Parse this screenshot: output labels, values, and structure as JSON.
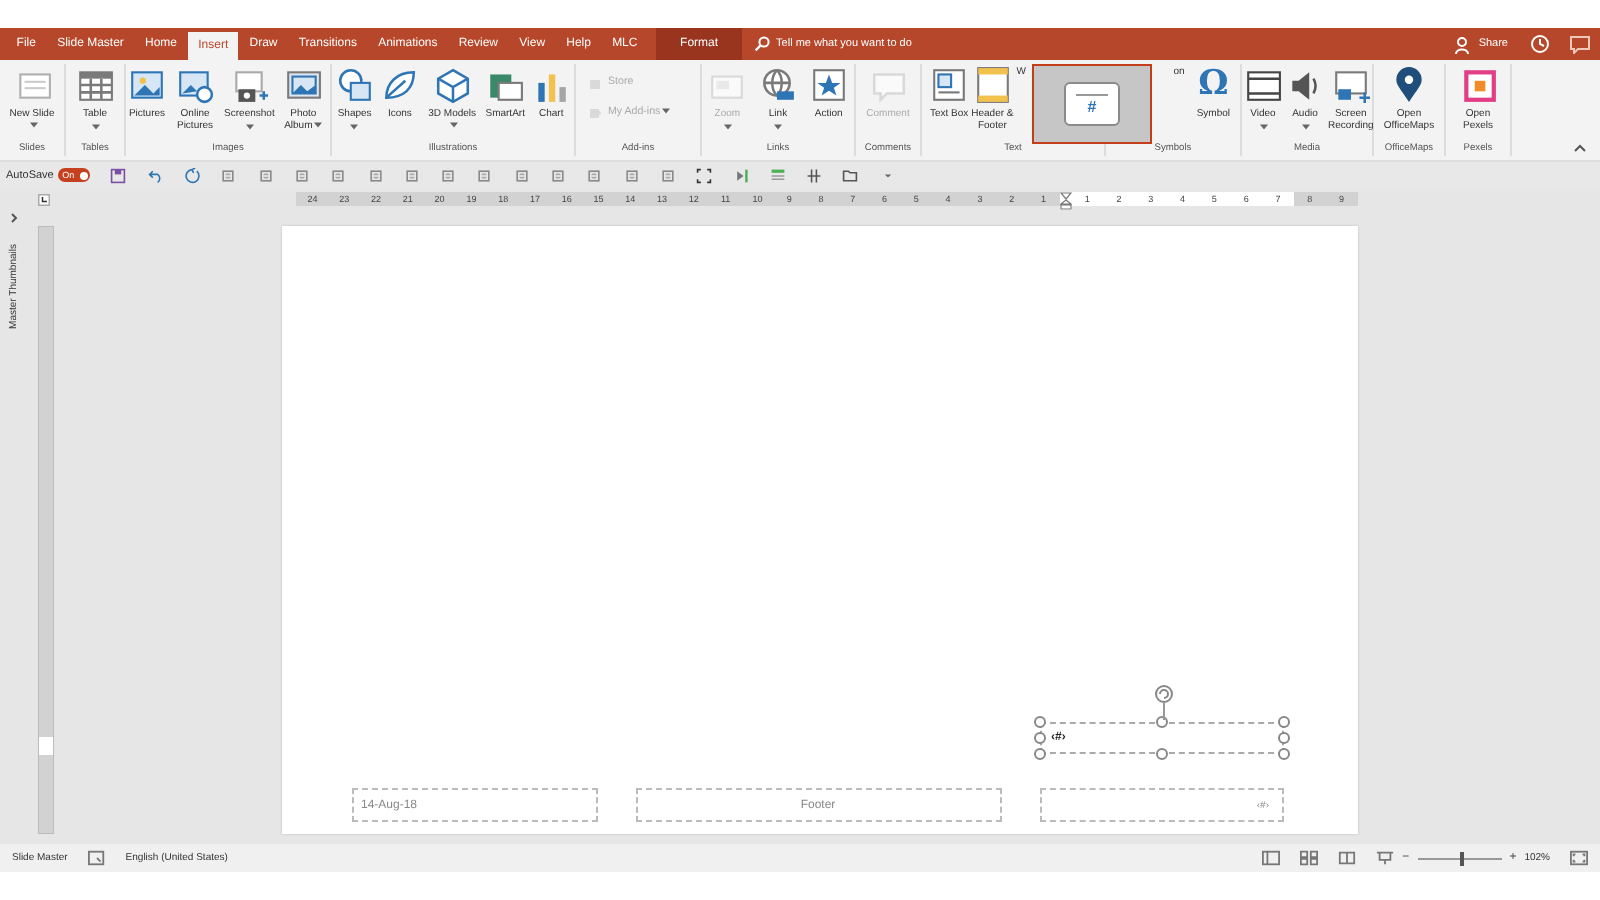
{
  "tabs": [
    {
      "label": "File",
      "selected": false,
      "contextual": false
    },
    {
      "label": "Slide Master",
      "selected": false,
      "contextual": false
    },
    {
      "label": "Home",
      "selected": false,
      "contextual": false
    },
    {
      "label": "Insert",
      "selected": true,
      "contextual": false
    },
    {
      "label": "Draw",
      "selected": false,
      "contextual": false
    },
    {
      "label": "Transitions",
      "selected": false,
      "contextual": false
    },
    {
      "label": "Animations",
      "selected": false,
      "contextual": false
    },
    {
      "label": "Review",
      "selected": false,
      "contextual": false
    },
    {
      "label": "View",
      "selected": false,
      "contextual": false
    },
    {
      "label": "Help",
      "selected": false,
      "contextual": false
    },
    {
      "label": "MLC",
      "selected": false,
      "contextual": false
    },
    {
      "label": "Format",
      "selected": false,
      "contextual": true
    }
  ],
  "tell_me": {
    "placeholder": "Tell me what you want to do"
  },
  "share": "Share",
  "ribbon": {
    "groups": [
      {
        "label": "Slides",
        "kind": "large",
        "buttons": [
          {
            "label": "New Slide",
            "kind": "caret-inline",
            "disabled": false
          }
        ]
      },
      {
        "label": "Tables",
        "kind": "large",
        "buttons": [
          {
            "label": "Table",
            "kind": "caret-below",
            "disabled": false
          }
        ]
      },
      {
        "label": "Images",
        "kind": "large",
        "buttons": [
          {
            "label": "Pictures",
            "kind": "plain",
            "disabled": false
          },
          {
            "label": "Online Pictures",
            "kind": "plain",
            "disabled": false
          },
          {
            "label": "Screenshot",
            "kind": "caret-below",
            "disabled": false
          },
          {
            "label": "Photo Album",
            "kind": "caret-inline",
            "disabled": false
          }
        ]
      },
      {
        "label": "Illustrations",
        "kind": "large",
        "buttons": [
          {
            "label": "Shapes",
            "kind": "caret-below",
            "disabled": false
          },
          {
            "label": "Icons",
            "kind": "plain",
            "disabled": false
          },
          {
            "label": "3D Models",
            "kind": "caret-inline",
            "disabled": false
          },
          {
            "label": "SmartArt",
            "kind": "plain",
            "disabled": false
          },
          {
            "label": "Chart",
            "kind": "plain",
            "disabled": false
          }
        ]
      },
      {
        "label": "Add-ins",
        "kind": "compact",
        "buttons": [
          {
            "label": "Store",
            "kind": "plain",
            "disabled": true
          },
          {
            "label": "My Add-ins",
            "kind": "caret-inline",
            "disabled": true
          }
        ]
      },
      {
        "label": "Links",
        "kind": "large",
        "buttons": [
          {
            "label": "Zoom",
            "kind": "caret-below",
            "disabled": true
          },
          {
            "label": "Link",
            "kind": "caret-below",
            "disabled": false
          },
          {
            "label": "Action",
            "kind": "plain",
            "disabled": false
          }
        ]
      },
      {
        "label": "Comments",
        "kind": "large",
        "buttons": [
          {
            "label": "Comment",
            "kind": "plain",
            "disabled": true
          }
        ]
      },
      {
        "label": "Text",
        "kind": "large",
        "buttons": [
          {
            "label": "Text Box",
            "kind": "plain",
            "disabled": false
          },
          {
            "label": "Header & Footer",
            "kind": "plain",
            "disabled": false
          },
          {
            "label": "W",
            "kind": "plain",
            "disabled": false
          }
        ]
      },
      {
        "label": "Symbols",
        "kind": "large",
        "buttons": [
          {
            "label": "on",
            "kind": "plain",
            "disabled": false
          },
          {
            "label": "Symbol",
            "kind": "plain",
            "glyph": "Ω",
            "disabled": false
          }
        ]
      },
      {
        "label": "Media",
        "kind": "large",
        "buttons": [
          {
            "label": "Video",
            "kind": "caret-below",
            "disabled": false
          },
          {
            "label": "Audio",
            "kind": "caret-below",
            "disabled": false
          },
          {
            "label": "Screen Recording",
            "kind": "plain",
            "disabled": false
          }
        ]
      },
      {
        "label": "OfficeMaps",
        "kind": "large",
        "buttons": [
          {
            "label": "Open OfficeMaps",
            "kind": "plain",
            "disabled": false
          }
        ]
      },
      {
        "label": "Pexels",
        "kind": "large",
        "buttons": [
          {
            "label": "Open Pexels",
            "kind": "plain",
            "disabled": false
          }
        ]
      }
    ]
  },
  "preview": {
    "glyph": "#"
  },
  "quick_access": {
    "label": "AutoSave",
    "toggle": {
      "label": "On",
      "on": true
    }
  },
  "ruler": {
    "ticks": [
      {
        "label": "24",
        "inside": false
      },
      {
        "label": "23",
        "inside": false
      },
      {
        "label": "22",
        "inside": false
      },
      {
        "label": "21",
        "inside": false
      },
      {
        "label": "20",
        "inside": false
      },
      {
        "label": "19",
        "inside": false
      },
      {
        "label": "18",
        "inside": false
      },
      {
        "label": "17",
        "inside": false
      },
      {
        "label": "16",
        "inside": false
      },
      {
        "label": "15",
        "inside": false
      },
      {
        "label": "14",
        "inside": false
      },
      {
        "label": "13",
        "inside": false
      },
      {
        "label": "12",
        "inside": false
      },
      {
        "label": "11",
        "inside": false
      },
      {
        "label": "10",
        "inside": false
      },
      {
        "label": "9",
        "inside": false
      },
      {
        "label": "8",
        "inside": false
      },
      {
        "label": "7",
        "inside": false
      },
      {
        "label": "6",
        "inside": false
      },
      {
        "label": "5",
        "inside": false
      },
      {
        "label": "4",
        "inside": false
      },
      {
        "label": "3",
        "inside": false
      },
      {
        "label": "2",
        "inside": false
      },
      {
        "label": "1",
        "inside": false
      },
      {
        "label": "1",
        "inside": true
      },
      {
        "label": "2",
        "inside": true
      },
      {
        "label": "3",
        "inside": true
      },
      {
        "label": "4",
        "inside": true
      },
      {
        "label": "5",
        "inside": true
      },
      {
        "label": "6",
        "inside": true
      },
      {
        "label": "7",
        "inside": true
      },
      {
        "label": "8",
        "inside": false
      },
      {
        "label": "9",
        "inside": false
      }
    ]
  },
  "left_pane": {
    "title": "Master Thumbnails"
  },
  "slide": {
    "date": "14-Aug-18",
    "footer": "Footer",
    "number": "‹#›",
    "selected_box": {
      "text": "‹#›"
    }
  },
  "status_bar": {
    "view": "Slide Master",
    "language": "English (United States)",
    "zoom_out": "−",
    "zoom_in": "+",
    "zoom_slider": {
      "level": 0.5
    },
    "zoom": "102%"
  }
}
